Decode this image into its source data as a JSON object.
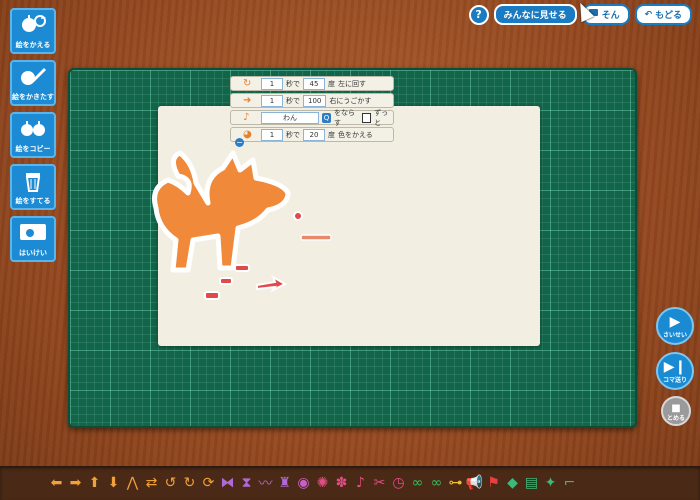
{
  "topbar": {
    "help": "?",
    "share_label": "みんなに見せる",
    "save_label": "そん",
    "back_label": "もどる"
  },
  "left_panel": [
    {
      "name": "change-picture-button",
      "label": "絵をかえる",
      "icon": "apples-refresh-icon",
      "glyph": "🍎"
    },
    {
      "name": "draw-picture-button",
      "label": "絵をかきたす",
      "icon": "pencil-icon",
      "glyph": "✎"
    },
    {
      "name": "copy-picture-button",
      "label": "絵をコピー",
      "icon": "two-apples-icon",
      "glyph": "🍎"
    },
    {
      "name": "trash-picture-button",
      "label": "絵をすてる",
      "icon": "trash-icon",
      "glyph": "🗑"
    },
    {
      "name": "background-button",
      "label": "はいけい",
      "icon": "picture-frame-icon",
      "glyph": "▭"
    }
  ],
  "code_blocks": [
    {
      "icon": "rotate-icon",
      "glyph": "↻",
      "fields": [
        "1",
        "秒で",
        "45",
        "度",
        "左に回す"
      ]
    },
    {
      "icon": "move-icon",
      "glyph": "➜",
      "fields": [
        "1",
        "秒で",
        "100",
        "右にうごかす"
      ]
    },
    {
      "icon": "sound-icon",
      "glyph": "♪",
      "fields": [
        "わん",
        "をならす",
        "ずっと"
      ]
    },
    {
      "icon": "color-icon",
      "glyph": "◕",
      "fields": [
        "1",
        "秒で",
        "20",
        "度",
        "色をかえる"
      ]
    }
  ],
  "right_controls": {
    "play": "さいせい",
    "step": "コマ送り",
    "stop": "とめる"
  },
  "colors": {
    "accent": "#1a8ad2",
    "board": "#14644a",
    "wood": "#94481f",
    "dog": "#f08a3a"
  },
  "bottom_tools": [
    {
      "name": "left-arrow-tool",
      "glyph": "⬅",
      "color": "#f2a13a"
    },
    {
      "name": "right-arrow-tool",
      "glyph": "➡",
      "color": "#f2a13a"
    },
    {
      "name": "up-arrow-tool",
      "glyph": "⬆",
      "color": "#f2a13a"
    },
    {
      "name": "down-arrow-tool",
      "glyph": "⬇",
      "color": "#f2a13a"
    },
    {
      "name": "jump-tool",
      "glyph": "⋀",
      "color": "#f2a13a"
    },
    {
      "name": "swap-tool",
      "glyph": "⇄",
      "color": "#f2a13a"
    },
    {
      "name": "rotate-left-tool",
      "glyph": "↺",
      "color": "#f2a13a"
    },
    {
      "name": "rotate-right-tool",
      "glyph": "↻",
      "color": "#f2a13a"
    },
    {
      "name": "spin-tool",
      "glyph": "⟳",
      "color": "#f2a13a"
    },
    {
      "name": "flip-tool",
      "glyph": "⧓",
      "color": "#b06ad6"
    },
    {
      "name": "hourglass-tool",
      "glyph": "⧗",
      "color": "#b06ad6"
    },
    {
      "name": "wave-tool",
      "glyph": "〰",
      "color": "#b06ad6"
    },
    {
      "name": "castle-tool",
      "glyph": "♜",
      "color": "#b06ad6"
    },
    {
      "name": "size-tool",
      "glyph": "◉",
      "color": "#c861c6"
    },
    {
      "name": "speech-tool",
      "glyph": "✺",
      "color": "#e24e86"
    },
    {
      "name": "flower-tool",
      "glyph": "✽",
      "color": "#e24e86"
    },
    {
      "name": "music-tool",
      "glyph": "♪",
      "color": "#e24e86"
    },
    {
      "name": "scissors-tool",
      "glyph": "✂",
      "color": "#e24e86"
    },
    {
      "name": "clock-tool",
      "glyph": "◷",
      "color": "#e24e86"
    },
    {
      "name": "loop-tool",
      "glyph": "∞",
      "color": "#2fbf5a"
    },
    {
      "name": "infinite-tool",
      "glyph": "∞",
      "color": "#2fbf5a"
    },
    {
      "name": "signal-tool",
      "glyph": "⊶",
      "color": "#f2c029"
    },
    {
      "name": "megaphone-tool",
      "glyph": "📢",
      "color": "#e84040"
    },
    {
      "name": "flag-tool",
      "glyph": "⚑",
      "color": "#e84040"
    },
    {
      "name": "bag-tool",
      "glyph": "◆",
      "color": "#3cb878"
    },
    {
      "name": "camera-tool",
      "glyph": "▤",
      "color": "#3cb878"
    },
    {
      "name": "star-tool",
      "glyph": "✦",
      "color": "#3cb878"
    },
    {
      "name": "gun-tool",
      "glyph": "⌐",
      "color": "#3cb878"
    }
  ]
}
